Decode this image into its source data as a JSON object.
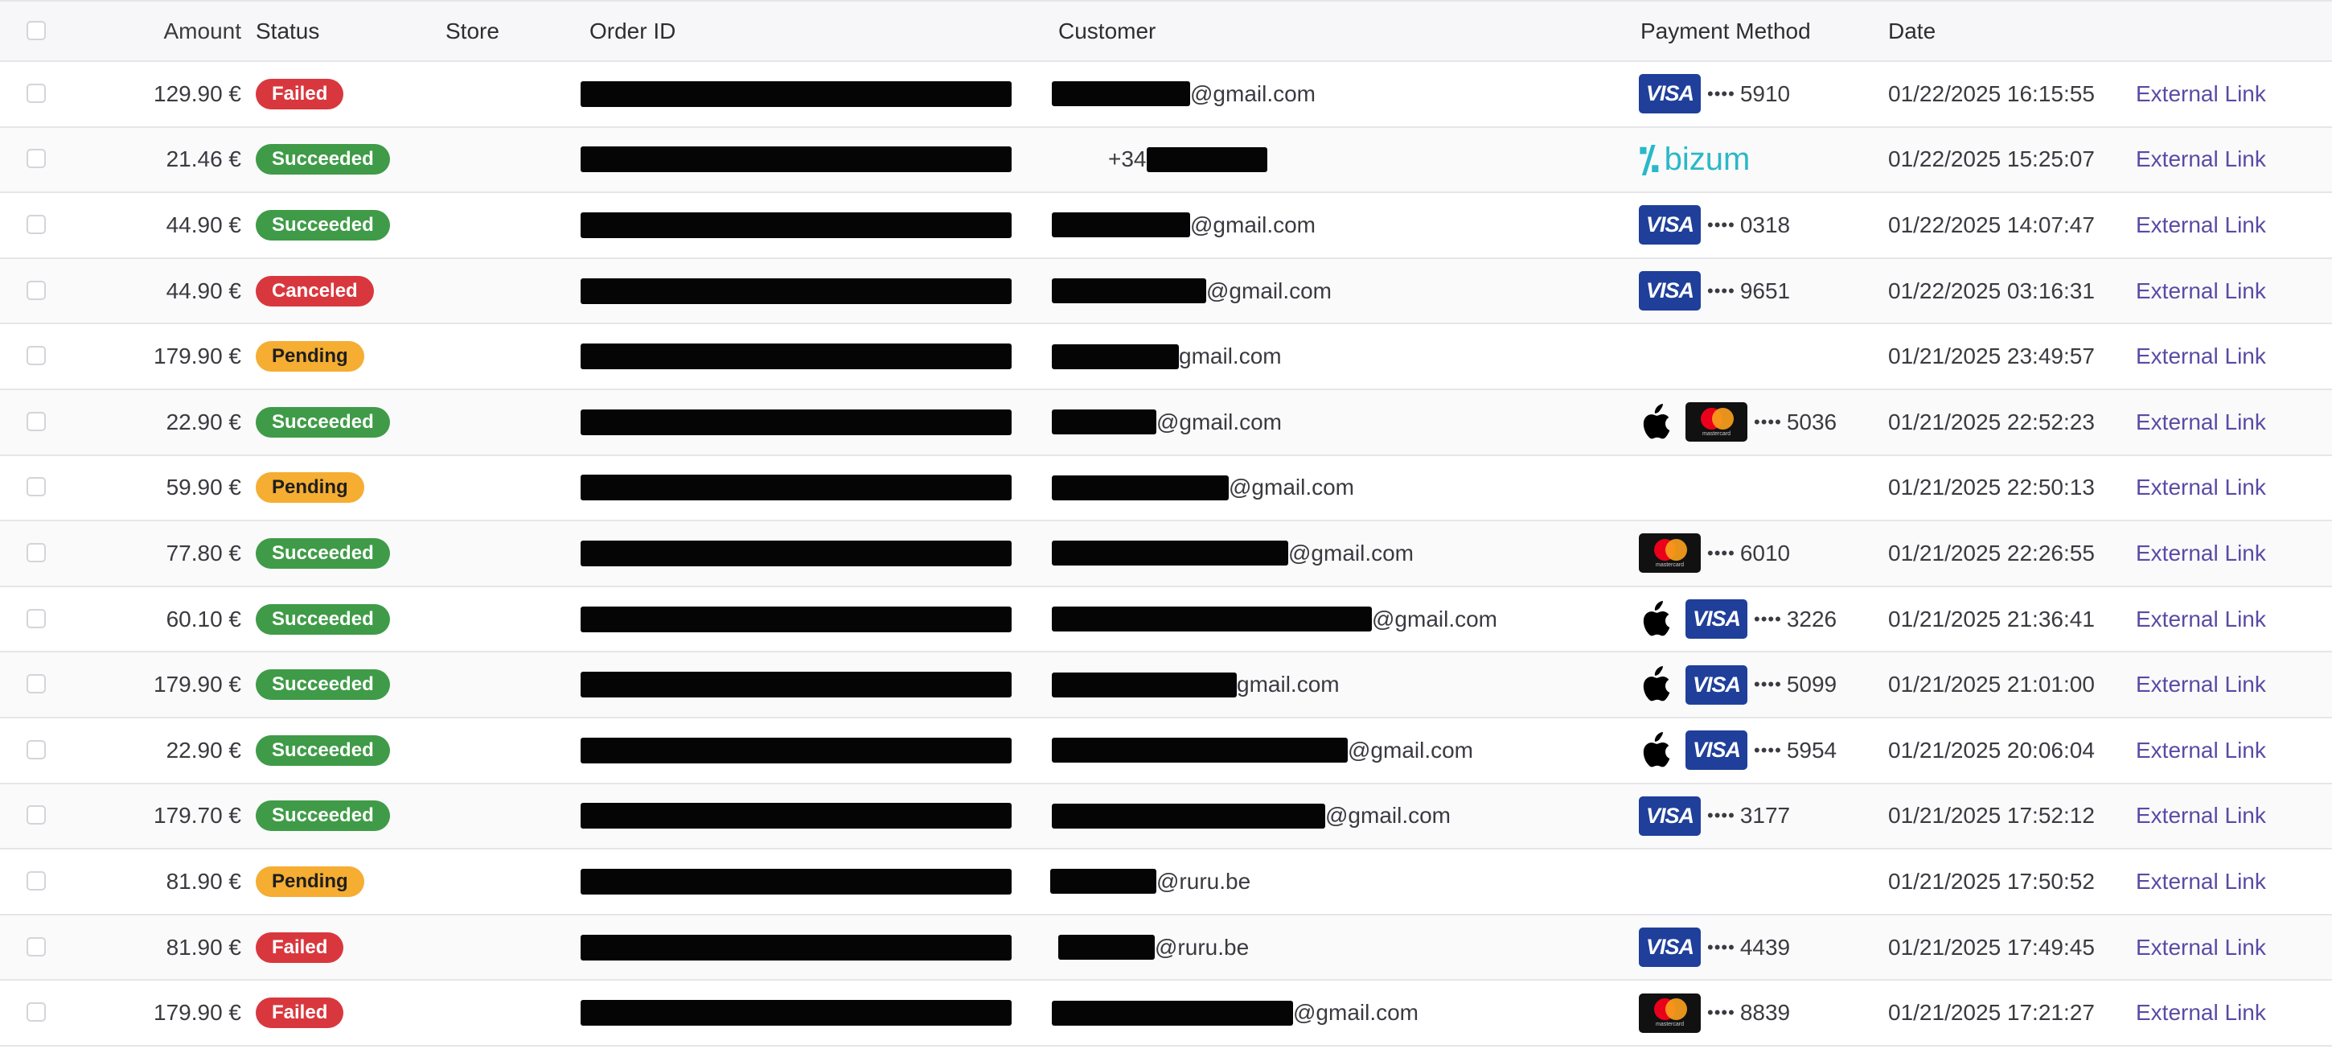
{
  "header": {
    "amount": "Amount",
    "status": "Status",
    "store": "Store",
    "order_id": "Order ID",
    "customer": "Customer",
    "payment_method": "Payment Method",
    "date": "Date"
  },
  "status_colors": {
    "Failed": "#d9373e",
    "Succeeded": "#3f9b47",
    "Canceled": "#d9373e",
    "Pending": "#f5ad32"
  },
  "status_text_colors": {
    "Failed": "#ffffff",
    "Succeeded": "#ffffff",
    "Canceled": "#ffffff",
    "Pending": "#1f1f1f"
  },
  "link_color": "#5a4aa5",
  "rows": [
    {
      "amount": "129.90 €",
      "status": "Failed",
      "customer_text": "@gmail.com",
      "payment": {
        "wallet": "",
        "brand": "visa",
        "last4": "5910"
      },
      "date": "01/22/2025 16:15:55",
      "link": "External Link"
    },
    {
      "amount": "21.46 €",
      "status": "Succeeded",
      "customer_text": "+34",
      "payment": {
        "wallet": "",
        "brand": "bizum",
        "last4": ""
      },
      "date": "01/22/2025 15:25:07",
      "link": "External Link"
    },
    {
      "amount": "44.90 €",
      "status": "Succeeded",
      "customer_text": "@gmail.com",
      "payment": {
        "wallet": "",
        "brand": "visa",
        "last4": "0318"
      },
      "date": "01/22/2025 14:07:47",
      "link": "External Link"
    },
    {
      "amount": "44.90 €",
      "status": "Canceled",
      "customer_text": "@gmail.com",
      "payment": {
        "wallet": "",
        "brand": "visa",
        "last4": "9651"
      },
      "date": "01/22/2025 03:16:31",
      "link": "External Link"
    },
    {
      "amount": "179.90 €",
      "status": "Pending",
      "customer_text": "gmail.com",
      "payment": {
        "wallet": "",
        "brand": "",
        "last4": ""
      },
      "date": "01/21/2025 23:49:57",
      "link": "External Link"
    },
    {
      "amount": "22.90 €",
      "status": "Succeeded",
      "customer_text": "@gmail.com",
      "payment": {
        "wallet": "apple",
        "brand": "mastercard",
        "last4": "5036"
      },
      "date": "01/21/2025 22:52:23",
      "link": "External Link"
    },
    {
      "amount": "59.90 €",
      "status": "Pending",
      "customer_text": "@gmail.com",
      "payment": {
        "wallet": "",
        "brand": "",
        "last4": ""
      },
      "date": "01/21/2025 22:50:13",
      "link": "External Link"
    },
    {
      "amount": "77.80 €",
      "status": "Succeeded",
      "customer_text": "@gmail.com",
      "payment": {
        "wallet": "",
        "brand": "mastercard",
        "last4": "6010"
      },
      "date": "01/21/2025 22:26:55",
      "link": "External Link"
    },
    {
      "amount": "60.10 €",
      "status": "Succeeded",
      "customer_text": "@gmail.com",
      "payment": {
        "wallet": "apple",
        "brand": "visa",
        "last4": "3226"
      },
      "date": "01/21/2025 21:36:41",
      "link": "External Link"
    },
    {
      "amount": "179.90 €",
      "status": "Succeeded",
      "customer_text": "gmail.com",
      "payment": {
        "wallet": "apple",
        "brand": "visa",
        "last4": "5099"
      },
      "date": "01/21/2025 21:01:00",
      "link": "External Link"
    },
    {
      "amount": "22.90 €",
      "status": "Succeeded",
      "customer_text": "@gmail.com",
      "payment": {
        "wallet": "apple",
        "brand": "visa",
        "last4": "5954"
      },
      "date": "01/21/2025 20:06:04",
      "link": "External Link"
    },
    {
      "amount": "179.70 €",
      "status": "Succeeded",
      "customer_text": "@gmail.com",
      "payment": {
        "wallet": "",
        "brand": "visa",
        "last4": "3177"
      },
      "date": "01/21/2025 17:52:12",
      "link": "External Link"
    },
    {
      "amount": "81.90 €",
      "status": "Pending",
      "customer_text": "@ruru.be",
      "payment": {
        "wallet": "",
        "brand": "",
        "last4": ""
      },
      "date": "01/21/2025 17:50:52",
      "link": "External Link"
    },
    {
      "amount": "81.90 €",
      "status": "Failed",
      "customer_text": "@ruru.be",
      "payment": {
        "wallet": "",
        "brand": "visa",
        "last4": "4439"
      },
      "date": "01/21/2025 17:49:45",
      "link": "External Link"
    },
    {
      "amount": "179.90 €",
      "status": "Failed",
      "customer_text": "@gmail.com",
      "payment": {
        "wallet": "",
        "brand": "mastercard",
        "last4": "8839"
      },
      "date": "01/21/2025 17:21:27",
      "link": "External Link"
    }
  ],
  "icons": {
    "visa": "visa-card-icon",
    "mastercard": "mastercard-icon",
    "apple": "apple-pay-icon",
    "bizum": "bizum-logo",
    "visa_text": "VISA",
    "mastercard_text": "mastercard",
    "bizum_text": "bizum",
    "dots": "••••"
  }
}
